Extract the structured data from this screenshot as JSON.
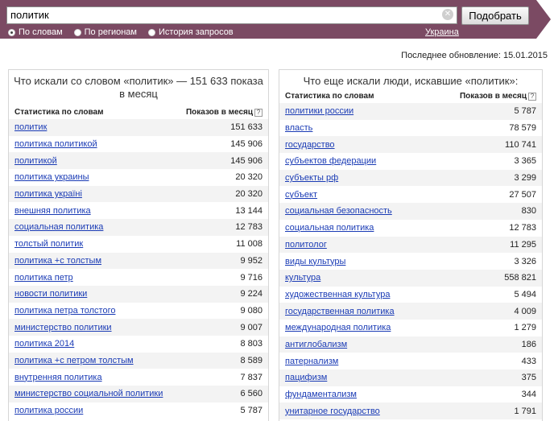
{
  "search": {
    "query": "политик",
    "clear_icon": "close-icon",
    "submit_label": "Подобрать",
    "modes": [
      {
        "label": "По словам",
        "selected": true
      },
      {
        "label": "По регионам",
        "selected": false
      },
      {
        "label": "История запросов",
        "selected": false
      }
    ],
    "region": "Украина"
  },
  "updated_text": "Последнее обновление: 15.01.2015",
  "left": {
    "title": "Что искали со словом «политик» — 151 633 показа в месяц",
    "col_keyword": "Статистика по словам",
    "col_count": "Показов в месяц",
    "help": "?",
    "rows": [
      {
        "kw": "политик",
        "cnt": "151 633"
      },
      {
        "kw": "политика политикой",
        "cnt": "145 906"
      },
      {
        "kw": "политикой",
        "cnt": "145 906"
      },
      {
        "kw": "политика украины",
        "cnt": "20 320"
      },
      {
        "kw": "политика україні",
        "cnt": "20 320"
      },
      {
        "kw": "внешняя политика",
        "cnt": "13 144"
      },
      {
        "kw": "социальная политика",
        "cnt": "12 783"
      },
      {
        "kw": "толстый политик",
        "cnt": "11 008"
      },
      {
        "kw": "политика +с толстым",
        "cnt": "9 952"
      },
      {
        "kw": "политика петр",
        "cnt": "9 716"
      },
      {
        "kw": "новости политики",
        "cnt": "9 224"
      },
      {
        "kw": "политика петра толстого",
        "cnt": "9 080"
      },
      {
        "kw": "министерство политики",
        "cnt": "9 007"
      },
      {
        "kw": "политика 2014",
        "cnt": "8 803"
      },
      {
        "kw": "политика +с петром толстым",
        "cnt": "8 589"
      },
      {
        "kw": "внутренняя политика",
        "cnt": "7 837"
      },
      {
        "kw": "министерство социальной политики",
        "cnt": "6 560"
      },
      {
        "kw": "политика россии",
        "cnt": "5 787"
      }
    ]
  },
  "right": {
    "title": "Что еще искали люди, искавшие «политик»:",
    "col_keyword": "Статистика по словам",
    "col_count": "Показов в месяц",
    "help": "?",
    "rows": [
      {
        "kw": "политики россии",
        "cnt": "5 787"
      },
      {
        "kw": "власть",
        "cnt": "78 579"
      },
      {
        "kw": "государство",
        "cnt": "110 741"
      },
      {
        "kw": "субъектов федерации",
        "cnt": "3 365"
      },
      {
        "kw": "субъекты рф",
        "cnt": "3 299"
      },
      {
        "kw": "субъект",
        "cnt": "27 507"
      },
      {
        "kw": "социальная безопасность",
        "cnt": "830"
      },
      {
        "kw": "социальная политика",
        "cnt": "12 783"
      },
      {
        "kw": "политолог",
        "cnt": "11 295"
      },
      {
        "kw": "виды культуры",
        "cnt": "3 326"
      },
      {
        "kw": "культура",
        "cnt": "558 821"
      },
      {
        "kw": "художественная культура",
        "cnt": "5 494"
      },
      {
        "kw": "государственная политика",
        "cnt": "4 009"
      },
      {
        "kw": "международная политика",
        "cnt": "1 279"
      },
      {
        "kw": "антиглобализм",
        "cnt": "186"
      },
      {
        "kw": "патернализм",
        "cnt": "433"
      },
      {
        "kw": "пацифизм",
        "cnt": "375"
      },
      {
        "kw": "фундаментализм",
        "cnt": "344"
      },
      {
        "kw": "унитарное государство",
        "cnt": "1 791"
      }
    ]
  }
}
